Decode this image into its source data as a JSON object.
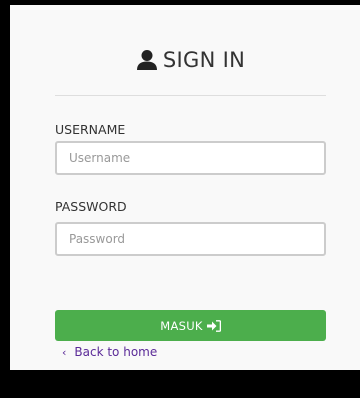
{
  "login": {
    "title": "SIGN IN",
    "username_label": "USERNAME",
    "username_placeholder": "Username",
    "password_label": "PASSWORD",
    "password_placeholder": "Password",
    "submit_label": "MASUK",
    "back_label": "Back to home",
    "back_chevron": "‹"
  },
  "icons": {
    "title_icon": "user-icon",
    "submit_icon": "sign-in-icon"
  },
  "colors": {
    "submit_bg": "#4cae4c",
    "link": "#5b2b98",
    "frame": "#000000"
  }
}
